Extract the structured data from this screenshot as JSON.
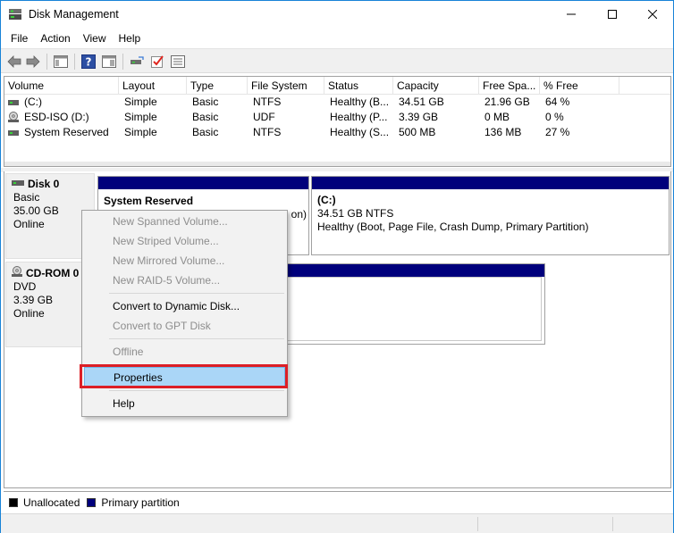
{
  "window": {
    "title": "Disk Management",
    "title_icon": "disk-management-icon",
    "controls": [
      "minimize-icon",
      "maximize-icon",
      "close-icon"
    ]
  },
  "menubar": {
    "items": [
      "File",
      "Action",
      "View",
      "Help"
    ]
  },
  "toolbar": {
    "icons": [
      "back-arrow-icon",
      "forward-arrow-icon",
      "console-tree-icon",
      "help-icon",
      "show-pane-icon",
      "connect-drive-icon",
      "checkmark-icon",
      "properties-list-icon"
    ]
  },
  "volumes": {
    "columns": [
      "Volume",
      "Layout",
      "Type",
      "File System",
      "Status",
      "Capacity",
      "Free Spa...",
      "% Free"
    ],
    "rows": [
      {
        "icon": "drive-icon",
        "volume": "(C:)",
        "layout": "Simple",
        "type": "Basic",
        "fs": "NTFS",
        "status": "Healthy (B...",
        "capacity": "34.51 GB",
        "free": "21.96 GB",
        "pct": "64 %"
      },
      {
        "icon": "cd-drive-icon",
        "volume": "ESD-ISO (D:)",
        "layout": "Simple",
        "type": "Basic",
        "fs": "UDF",
        "status": "Healthy (P...",
        "capacity": "3.39 GB",
        "free": "0 MB",
        "pct": "0 %"
      },
      {
        "icon": "drive-icon",
        "volume": "System Reserved",
        "layout": "Simple",
        "type": "Basic",
        "fs": "NTFS",
        "status": "Healthy (S...",
        "capacity": "500 MB",
        "free": "136 MB",
        "pct": "27 %"
      }
    ]
  },
  "disks": [
    {
      "name": "Disk 0",
      "type": "Basic",
      "size": "35.00 GB",
      "state": "Online",
      "partitions": [
        {
          "title": "System Reserved",
          "line2": "",
          "line3": "on)"
        },
        {
          "title": "(C:)",
          "line2": "34.51 GB NTFS",
          "line3": "Healthy (Boot, Page File, Crash Dump, Primary Partition)"
        }
      ]
    },
    {
      "name": "CD-ROM 0",
      "type": "DVD",
      "size": "3.39 GB",
      "state": "Online"
    }
  ],
  "context_menu": {
    "items": [
      {
        "label": "New Spanned Volume...",
        "enabled": false
      },
      {
        "label": "New Striped Volume...",
        "enabled": false
      },
      {
        "label": "New Mirrored Volume...",
        "enabled": false
      },
      {
        "label": "New RAID-5 Volume...",
        "enabled": false
      },
      {
        "label": "Convert to Dynamic Disk...",
        "enabled": true
      },
      {
        "label": "Convert to GPT Disk",
        "enabled": false
      },
      {
        "label": "Offline",
        "enabled": false
      },
      {
        "label": "Properties",
        "enabled": true,
        "highlighted": true
      },
      {
        "label": "Help",
        "enabled": true
      }
    ]
  },
  "legend": {
    "items": [
      {
        "label": "Unallocated",
        "color": "#000000"
      },
      {
        "label": "Primary partition",
        "color": "#00007c"
      }
    ]
  },
  "colors": {
    "partition_stripe": "#00007c",
    "highlight": "#aad6f7",
    "callout_outline": "#dc1f26"
  }
}
